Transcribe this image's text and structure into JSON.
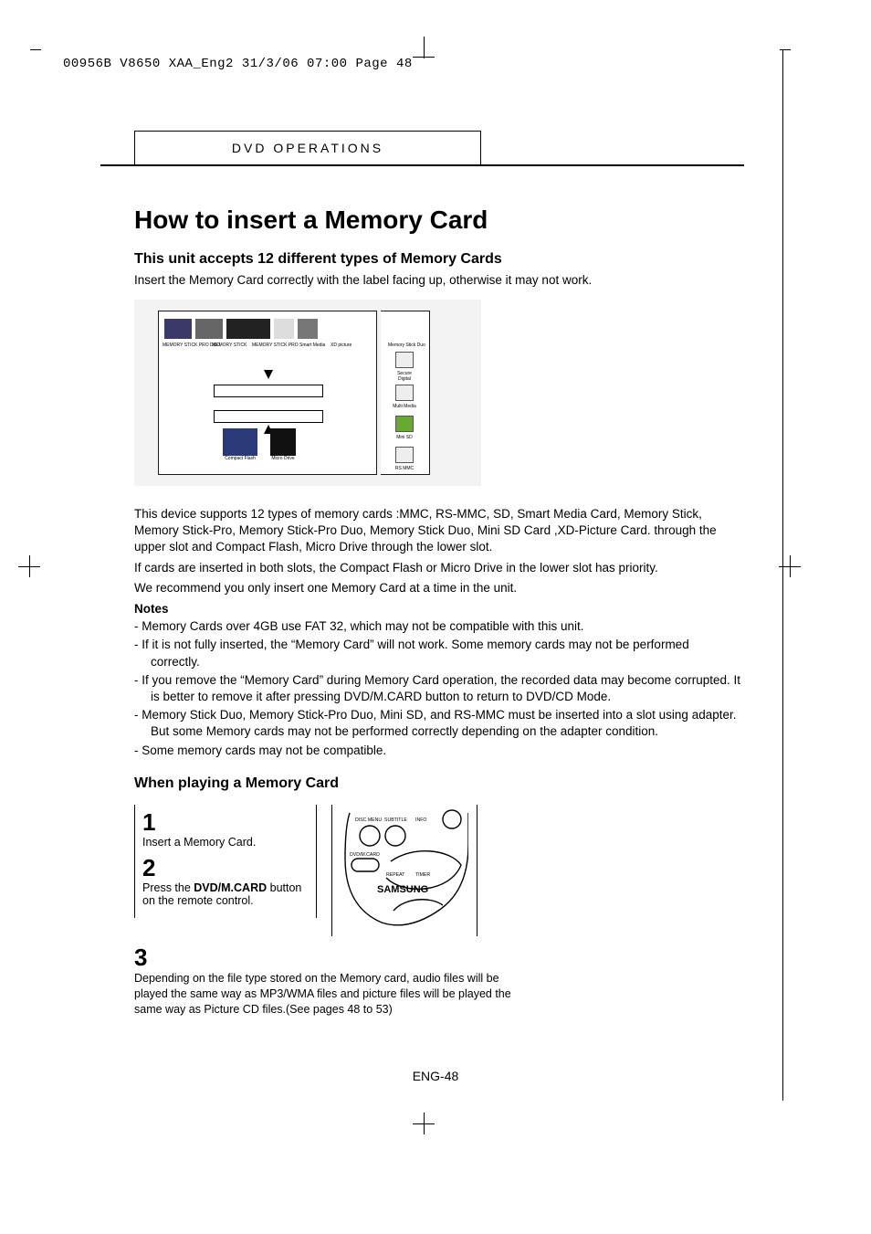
{
  "header_line": "00956B V8650 XAA_Eng2  31/3/06  07:00  Page 48",
  "section_tab": "DVD OPERATIONS",
  "title": "How to insert a Memory Card",
  "subhead": "This unit accepts 12 different types of Memory Cards",
  "intro": "Insert the Memory Card correctly with the label facing up, otherwise it may not work.",
  "figure1_labels": {
    "top": [
      "MEMORY STICK PRO DUO",
      "MEMORY STICK",
      "MEMORY STICK PRO",
      "Smart Media",
      "XD picture",
      "Memory Stick Duo"
    ],
    "side": [
      "Secure Digital",
      "Multi Media",
      "Mini SD",
      "RS MMC"
    ],
    "bottom": [
      "Compact Flash",
      "Micro Drive"
    ]
  },
  "body_paragraphs": [
    "This device supports 12 types of memory cards :MMC, RS-MMC, SD, Smart Media Card, Memory Stick, Memory Stick-Pro, Memory Stick-Pro Duo, Memory Stick Duo, Mini SD Card ,XD-Picture Card. through the upper slot and Compact Flash, Micro Drive through the lower slot.",
    "If cards are inserted in both slots, the Compact Flash or Micro Drive in the lower slot has priority.",
    "We recommend you only insert one Memory Card at a time in the unit."
  ],
  "notes_head": "Notes",
  "notes": [
    "Memory Cards over 4GB use FAT 32, which may not be compatible with this unit.",
    "If it is not fully inserted, the “Memory Card” will not work. Some memory cards may not be performed correctly.",
    "If you remove the “Memory Card” during Memory Card operation, the recorded data may become corrupted. It is better to remove it after pressing DVD/M.CARD button to return to DVD/CD Mode.",
    "Memory Stick Duo, Memory Stick-Pro Duo, Mini SD, and RS-MMC must be inserted into a slot using adapter. But some Memory cards may not be performed correctly depending on the adapter condition.",
    "Some memory cards may not be compatible."
  ],
  "play_head": "When playing a Memory Card",
  "steps": {
    "s1_num": "1",
    "s1_text": "Insert a Memory Card.",
    "s2_num": "2",
    "s2_pre": "Press the ",
    "s2_bold": "DVD/M.CARD",
    "s2_post": " button on the remote control.",
    "s3_num": "3",
    "s3_text": "Depending on the file type stored on the Memory card, audio files will be played the same way as MP3/WMA files and picture files will be played the same way as Picture CD files.(See pages 48 to 53)"
  },
  "remote_labels": {
    "disc_menu": "DISC MENU",
    "subtitle": "SUBTITLE",
    "info": "INFO",
    "dvdmcard": "DVD/M.CARD",
    "repeat": "REPEAT",
    "timer": "TIMER",
    "brand": "SAMSUNG"
  },
  "page_number": "ENG-48"
}
